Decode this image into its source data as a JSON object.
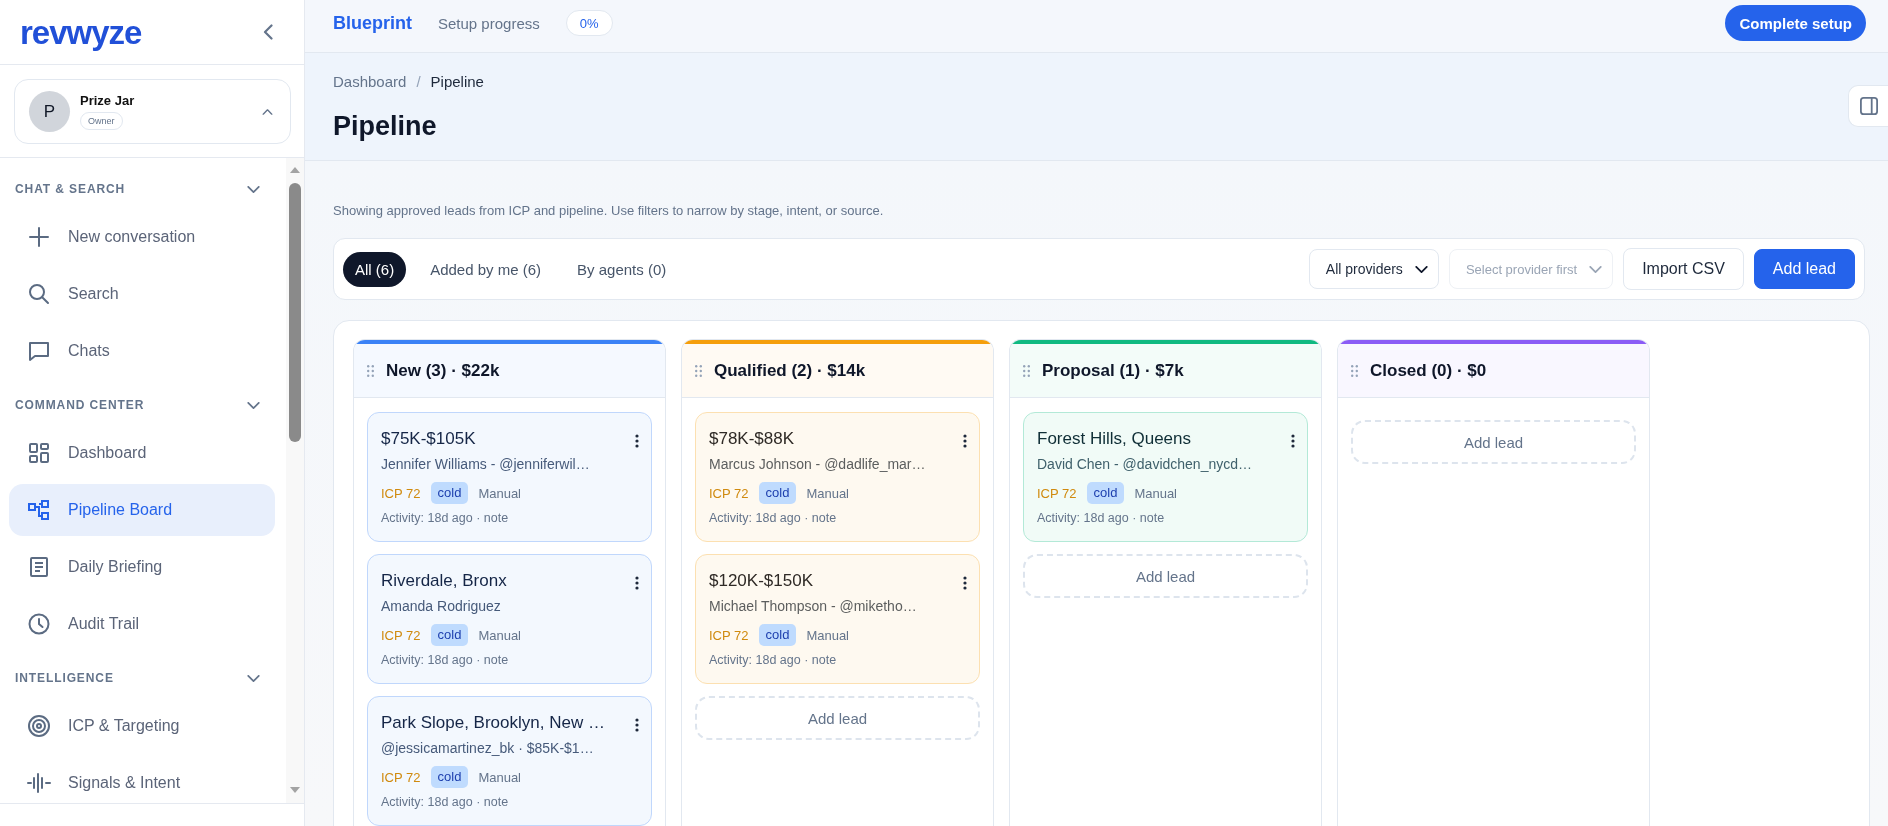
{
  "sidebar": {
    "logo": "revwyze",
    "account": {
      "initial": "P",
      "name": "Prize Jar",
      "role": "Owner"
    },
    "sections": [
      {
        "title": "CHAT & SEARCH",
        "expanded": true,
        "items": [
          {
            "label": "New conversation",
            "selected": false
          },
          {
            "label": "Search",
            "selected": false
          },
          {
            "label": "Chats",
            "selected": false
          }
        ]
      },
      {
        "title": "COMMAND CENTER",
        "expanded": true,
        "items": [
          {
            "label": "Dashboard",
            "selected": false
          },
          {
            "label": "Pipeline Board",
            "selected": true
          },
          {
            "label": "Daily Briefing",
            "selected": false
          },
          {
            "label": "Audit Trail",
            "selected": false
          }
        ]
      },
      {
        "title": "INTELLIGENCE",
        "expanded": true,
        "items": [
          {
            "label": "ICP & Targeting",
            "selected": false
          },
          {
            "label": "Signals & Intent",
            "selected": false
          }
        ]
      }
    ]
  },
  "top_bar": {
    "brand": "Blueprint",
    "progress_label": "Setup progress",
    "progress_value": "0%",
    "button": "Complete setup"
  },
  "header": {
    "breadcrumb": {
      "separator": "/",
      "items": [
        {
          "label": "Dashboard",
          "current": false
        },
        {
          "label": "Pipeline",
          "current": true
        }
      ]
    },
    "title": "Pipeline"
  },
  "filters": {
    "description": "Showing approved leads from ICP and pipeline. Use filters to narrow by stage, intent, or source.",
    "tabs": [
      {
        "label": "All (6)",
        "selected": true
      },
      {
        "label": "Added by me (6)",
        "selected": false
      },
      {
        "label": "By agents (0)",
        "selected": false
      }
    ],
    "dropdowns": [
      {
        "value": "All providers",
        "disabled": false
      },
      {
        "placeholder": "Select provider first",
        "disabled": true
      }
    ],
    "buttons": [
      {
        "label": "Import CSV",
        "kind": "secondary"
      },
      {
        "label": "Add lead",
        "kind": "primary"
      }
    ]
  },
  "board": {
    "columns": [
      {
        "title": "New (3) · $22k",
        "color": "#3b82f6",
        "cards": [
          {
            "title": "$75K-$105K",
            "subtitle": "Jennifer Williams - @jenniferwil…",
            "score": "ICP 72",
            "tag": "cold",
            "source": "Manual",
            "activity": "Activity: 18d ago · note"
          },
          {
            "title": "Riverdale, Bronx",
            "subtitle": "Amanda Rodriguez",
            "score": "ICP 72",
            "tag": "cold",
            "source": "Manual",
            "activity": "Activity: 18d ago · note"
          },
          {
            "title": "Park Slope, Brooklyn, New …",
            "subtitle": "@jessicamartinez_bk · $85K-$1…",
            "score": "ICP 72",
            "tag": "cold",
            "source": "Manual",
            "activity": "Activity: 18d ago · note"
          }
        ]
      },
      {
        "title": "Qualified (2) · $14k",
        "color": "#f59e0b",
        "cards": [
          {
            "title": "$78K-$88K",
            "subtitle": "Marcus Johnson - @dadlife_mar…",
            "score": "ICP 72",
            "tag": "cold",
            "source": "Manual",
            "activity": "Activity: 18d ago · note"
          },
          {
            "title": "$120K-$150K",
            "subtitle": "Michael Thompson - @miketho…",
            "score": "ICP 72",
            "tag": "cold",
            "source": "Manual",
            "activity": "Activity: 18d ago · note"
          }
        ],
        "add_label": "Add lead"
      },
      {
        "title": "Proposal (1) · $7k",
        "color": "#10b981",
        "cards": [
          {
            "title": "Forest Hills, Queens",
            "subtitle": "David Chen - @davidchen_nycd…",
            "score": "ICP 72",
            "tag": "cold",
            "source": "Manual",
            "activity": "Activity: 18d ago · note"
          }
        ],
        "add_label": "Add lead"
      },
      {
        "title": "Closed (0) · $0",
        "color": "#8b5cf6",
        "add_label": "Add lead"
      }
    ]
  }
}
